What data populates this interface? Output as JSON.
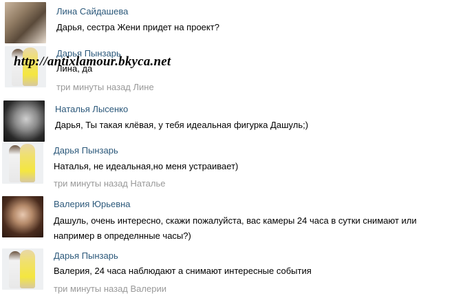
{
  "comments": [
    {
      "author": "Лина Сайдашева",
      "text": "Дарья, сестра Жени придет на проект?",
      "meta": ""
    },
    {
      "author": "Дарья Пынзарь",
      "text": "Лина, да",
      "meta": "три минуты назад Лине"
    },
    {
      "author": "Наталья Лысенко",
      "text": "Дарья, Ты такая клёвая, у тебя идеальная фигурка Дашуль;)",
      "meta": ""
    },
    {
      "author": "Дарья Пынзарь",
      "text": "Наталья, не идеальная,но меня устраивает)",
      "meta": "три минуты назад Наталье"
    },
    {
      "author": "Валерия Юрьевна",
      "text_line1": "Дашуль, очень интересно, скажи пожалуйста, вас камеры 24 часа в сутки снимают или",
      "text_line2": "например в определнные часы?)",
      "meta": ""
    },
    {
      "author": "Дарья Пынзарь",
      "text": "Валерия, 24 часа наблюдают а снимают интересные события",
      "meta": "три минуты назад Валерии"
    }
  ],
  "avatars": [
    "child-kiss-photo",
    "couple-photo",
    "woman-dark-hair-photo",
    "couple-photo",
    "woman-smiling-photo",
    "couple-photo"
  ],
  "watermark": "http://antixlamour.bkyca.net",
  "colors": {
    "author": "#2b587a",
    "text": "#000000",
    "meta": "#999999",
    "background": "#ffffff"
  }
}
